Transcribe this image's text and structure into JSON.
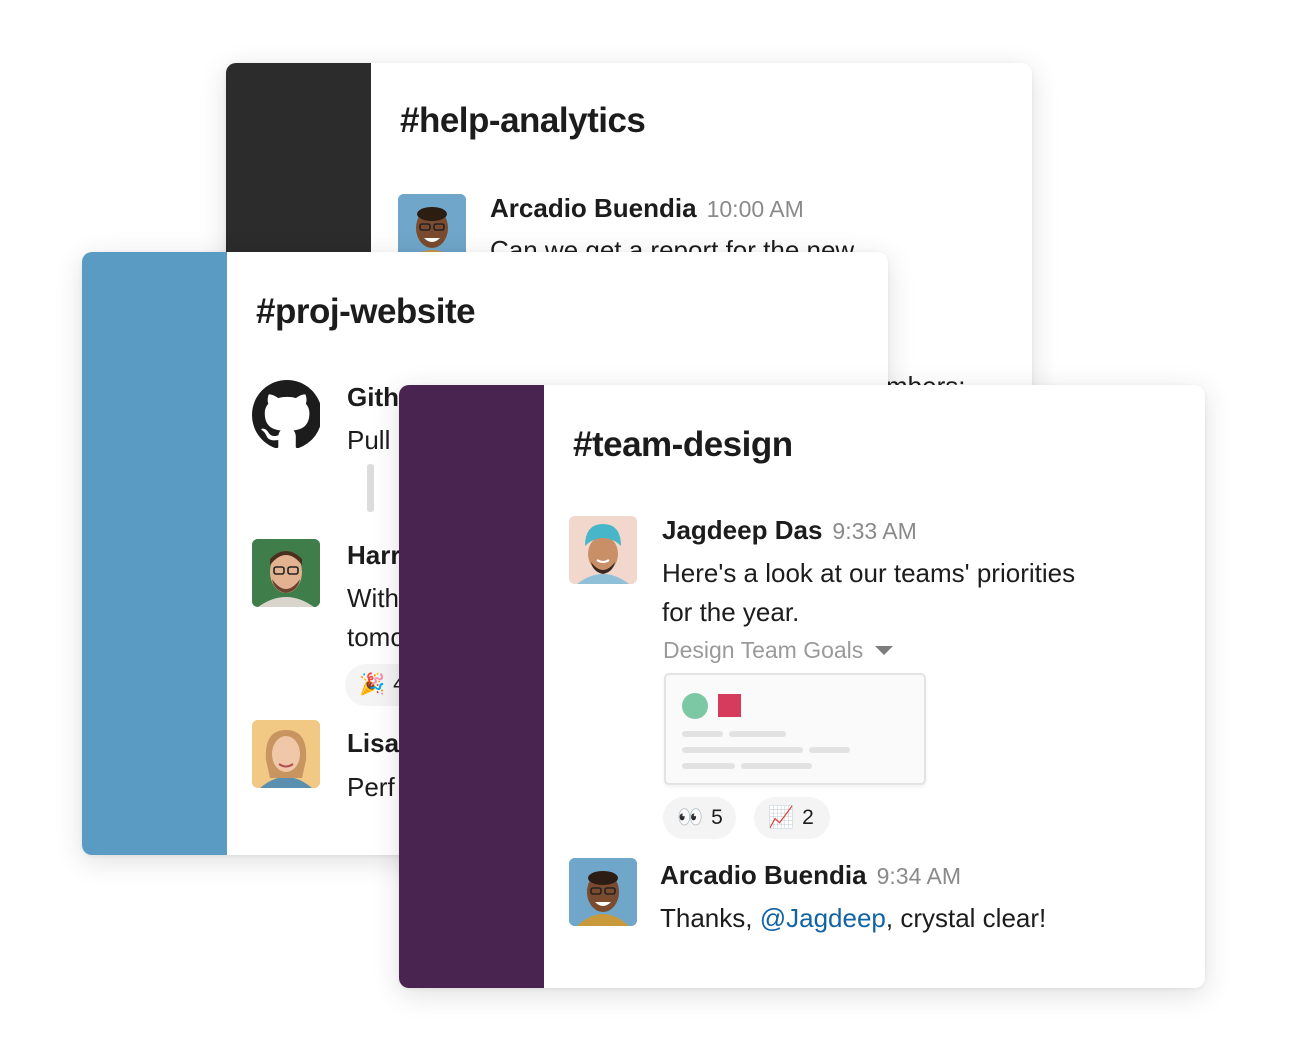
{
  "colors": {
    "analytics_sidebar": "#2c2c2c",
    "website_sidebar": "#5a9bc4",
    "design_sidebar": "#4a2450",
    "mention": "#1264a3"
  },
  "analytics": {
    "channel": "#help-analytics",
    "message": {
      "author": "Arcadio Buendia",
      "time": "10:00 AM",
      "text": "Can we get a report for the new",
      "peek_text": "mbers:"
    }
  },
  "website": {
    "channel": "#proj-website",
    "github": {
      "avatar_icon": "github-icon",
      "author_partial": "Gith",
      "text_partial": "Pull"
    },
    "harry": {
      "author_partial": "Harr",
      "line1_partial": "With",
      "line2_partial": "tomo",
      "reaction_emoji": "🎉",
      "reaction_count": "4"
    },
    "lisa": {
      "author_partial": "Lisa",
      "text_partial": "Perf"
    }
  },
  "design": {
    "channel": "#team-design",
    "message1": {
      "author": "Jagdeep Das",
      "time": "9:33 AM",
      "line1": "Here's a look at our teams' priorities",
      "line2": "for the year.",
      "attachment_title": "Design Team Goals",
      "reactions": [
        {
          "emoji": "👀",
          "count": "5"
        },
        {
          "emoji": "📈",
          "count": "2"
        }
      ]
    },
    "message2": {
      "author": "Arcadio Buendia",
      "time": "9:34 AM",
      "text_before": "Thanks, ",
      "mention": "@Jagdeep",
      "text_after": ", crystal clear!"
    }
  }
}
